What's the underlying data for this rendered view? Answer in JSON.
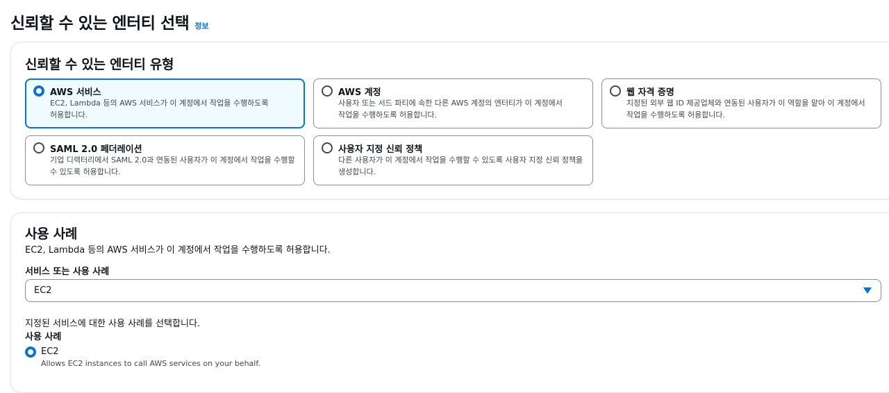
{
  "page": {
    "title": "신뢰할 수 있는 엔터티 선택",
    "info_link": "정보"
  },
  "entity_type_panel": {
    "heading": "신뢰할 수 있는 엔터티 유형",
    "selected": "aws_service",
    "options": [
      {
        "id": "aws_service",
        "title": "AWS 서비스",
        "description": "EC2, Lambda 등의 AWS 서비스가 이 계정에서 작업을 수행하도록 허용합니다.",
        "selected": true
      },
      {
        "id": "aws_account",
        "title": "AWS 계정",
        "description": "사용자 또는 서드 파티에 속한 다른 AWS 계정의 엔터티가 이 계정에서 작업을 수행하도록 허용합니다.",
        "selected": false
      },
      {
        "id": "web_identity",
        "title": "웹 자격 증명",
        "description": "지정된 외부 웹 ID 제공업체와 연동된 사용자가 이 역할을 맡아 이 계정에서 작업을 수행하도록 허용합니다.",
        "selected": false
      },
      {
        "id": "saml",
        "title": "SAML 2.0 페더레이션",
        "description": "기업 디렉터리에서 SAML 2.0과 연동된 사용자가 이 계정에서 작업을 수행할 수 있도록 허용합니다.",
        "selected": false
      },
      {
        "id": "custom_trust",
        "title": "사용자 지정 신뢰 정책",
        "description": "다른 사용자가 이 계정에서 작업을 수행할 수 있도록 사용자 지정 신뢰 정책을 생성합니다.",
        "selected": false
      }
    ]
  },
  "use_case_panel": {
    "heading": "사용 사례",
    "description": "EC2, Lambda 등의 AWS 서비스가 이 계정에서 작업을 수행하도록 허용합니다.",
    "service_label": "서비스 또는 사용 사례",
    "service_value": "EC2",
    "hint": "지정된 서비스에 대한 사용 사례를 선택합니다.",
    "use_case_label": "사용 사례",
    "use_case_option": {
      "title": "EC2",
      "description": "Allows EC2 instances to call AWS services on your behalf.",
      "selected": true
    }
  },
  "colors": {
    "accent": "#0972d3",
    "selected_tile_bg": "#f0fbff",
    "border": "#8c8c94",
    "text_secondary": "#424650"
  },
  "icons": {
    "select_caret": "caret-down-icon",
    "radio": "radio-icon"
  }
}
